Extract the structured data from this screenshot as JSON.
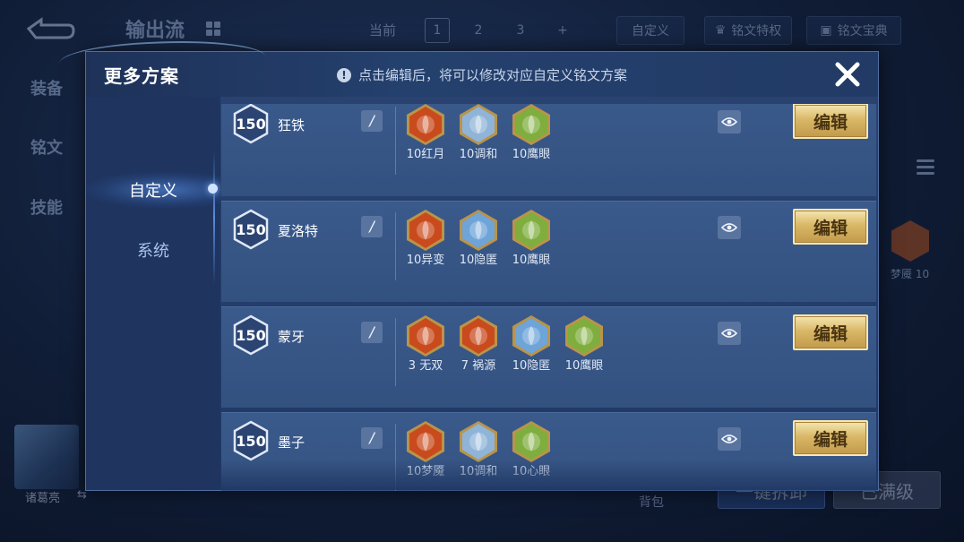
{
  "background": {
    "title": "输出流",
    "current_label": "当前",
    "pages": [
      "1",
      "2",
      "3",
      "+"
    ],
    "custom_button": "自定义",
    "privilege_button": "铭文特权",
    "dictionary_button": "铭文宝典",
    "side_tabs": [
      "装备",
      "铭文",
      "技能"
    ],
    "hero_name": "诸葛亮",
    "swap_symbol": "⇆",
    "bag_label": "背包",
    "buy_button": "一键拆卸",
    "full_button": "已满级",
    "rune_label": "梦魇 10"
  },
  "modal": {
    "title": "更多方案",
    "hint": "点击编辑后，将可以修改对应自定义铭文方案",
    "tabs": [
      {
        "label": "自定义",
        "active": true
      },
      {
        "label": "系统",
        "active": false
      }
    ],
    "edit_label": "编辑",
    "schemes": [
      {
        "level": "150",
        "name": "狂铁",
        "runes": [
          {
            "label": "10红月",
            "icon": "red-moon-rune-icon",
            "color": "#c94a1c"
          },
          {
            "label": "10调和",
            "icon": "harmony-rune-icon",
            "color": "#8fb4d8"
          },
          {
            "label": "10鹰眼",
            "icon": "eagle-eye-rune-icon",
            "color": "#7fae3e"
          }
        ]
      },
      {
        "level": "150",
        "name": "夏洛特",
        "runes": [
          {
            "label": "10异变",
            "icon": "mutation-rune-icon",
            "color": "#c94a1c"
          },
          {
            "label": "10隐匿",
            "icon": "stealth-rune-icon",
            "color": "#6ea4d8"
          },
          {
            "label": "10鹰眼",
            "icon": "eagle-eye-rune-icon",
            "color": "#7fae3e"
          }
        ]
      },
      {
        "level": "150",
        "name": "蒙牙",
        "runes": [
          {
            "label": "3 无双",
            "icon": "peerless-rune-icon",
            "color": "#c94a1c"
          },
          {
            "label": "7 祸源",
            "icon": "calamity-rune-icon",
            "color": "#c94a1c"
          },
          {
            "label": "10隐匿",
            "icon": "stealth-rune-icon",
            "color": "#6ea4d8"
          },
          {
            "label": "10鹰眼",
            "icon": "eagle-eye-rune-icon",
            "color": "#7fae3e"
          }
        ]
      },
      {
        "level": "150",
        "name": "墨子",
        "runes": [
          {
            "label": "10梦魇",
            "icon": "nightmare-rune-icon",
            "color": "#c94a1c"
          },
          {
            "label": "10调和",
            "icon": "harmony-rune-icon",
            "color": "#8fb4d8"
          },
          {
            "label": "10心眼",
            "icon": "mind-eye-rune-icon",
            "color": "#7fae3e"
          }
        ]
      }
    ]
  },
  "colors": {
    "accent_gold": "#d9b868",
    "panel_blue": "#2a4371",
    "row_blue": "#3a5a8c"
  }
}
